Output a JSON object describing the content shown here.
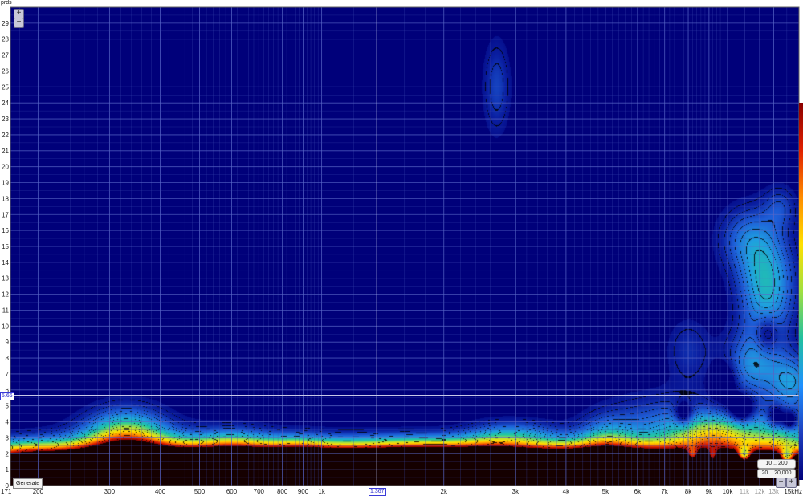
{
  "y_unit": "prds",
  "generate_label": "Generate",
  "range_buttons": [
    "10 .. 200",
    "20 .. 20,000"
  ],
  "cursor": {
    "x_label": "1.367",
    "y_label": "5.66"
  },
  "icons": {
    "zoom_in": "plus-icon",
    "zoom_out": "minus-icon"
  },
  "chart_data": {
    "type": "heatmap",
    "title": "",
    "xlabel": "",
    "ylabel": "prds",
    "x_scale": "log",
    "x_unit": "Hz",
    "xlim": [
      171,
      15000
    ],
    "ylim": [
      0,
      30
    ],
    "x_ticks": [
      {
        "value": 171,
        "label": "171"
      },
      {
        "value": 200,
        "label": "200"
      },
      {
        "value": 300,
        "label": "300"
      },
      {
        "value": 400,
        "label": "400"
      },
      {
        "value": 500,
        "label": "500"
      },
      {
        "value": 600,
        "label": "600"
      },
      {
        "value": 700,
        "label": "700"
      },
      {
        "value": 800,
        "label": "800"
      },
      {
        "value": 900,
        "label": "900"
      },
      {
        "value": 1000,
        "label": "1k"
      },
      {
        "value": 1367,
        "label": "1.367"
      },
      {
        "value": 2000,
        "label": "2k"
      },
      {
        "value": 3000,
        "label": "3k"
      },
      {
        "value": 4000,
        "label": "4k"
      },
      {
        "value": 5000,
        "label": "5k"
      },
      {
        "value": 6000,
        "label": "6k"
      },
      {
        "value": 7000,
        "label": "7k"
      },
      {
        "value": 8000,
        "label": "8k"
      },
      {
        "value": 9000,
        "label": "9k"
      },
      {
        "value": 10000,
        "label": "10k"
      },
      {
        "value": 11000,
        "label": "11k",
        "dim": true
      },
      {
        "value": 12000,
        "label": "12k",
        "dim": true
      },
      {
        "value": 13000,
        "label": "13k",
        "dim": true
      },
      {
        "value": 15000,
        "label": "15kHz"
      }
    ],
    "y_ticks": [
      0,
      1,
      2,
      3,
      4,
      5,
      6,
      7,
      8,
      9,
      10,
      11,
      12,
      13,
      14,
      15,
      16,
      17,
      18,
      19,
      20,
      21,
      22,
      23,
      24,
      25,
      26,
      27,
      28,
      29
    ],
    "cursor": {
      "x": 1367,
      "y": 5.66
    },
    "grid": true,
    "colormap": [
      "#00007a",
      "#0a1ea0",
      "#1e5fd8",
      "#1fa0e0",
      "#20c8a0",
      "#a8e040",
      "#ffe000",
      "#ff8c00",
      "#e02000",
      "#8b0000"
    ],
    "background_color": "#00137a",
    "blobs": [
      {
        "f": 200,
        "p": 0.3,
        "sf": 0.5,
        "sp": 1.1,
        "v": 1.0
      },
      {
        "f": 400,
        "p": 0.4,
        "sf": 0.5,
        "sp": 1.1,
        "v": 1.0
      },
      {
        "f": 700,
        "p": 0.4,
        "sf": 0.5,
        "sp": 1.1,
        "v": 1.0
      },
      {
        "f": 1200,
        "p": 0.4,
        "sf": 0.5,
        "sp": 1.1,
        "v": 1.0
      },
      {
        "f": 2000,
        "p": 0.4,
        "sf": 0.5,
        "sp": 1.1,
        "v": 1.0
      },
      {
        "f": 3500,
        "p": 0.4,
        "sf": 0.5,
        "sp": 1.1,
        "v": 1.0
      },
      {
        "f": 6000,
        "p": 0.4,
        "sf": 0.5,
        "sp": 1.1,
        "v": 1.0
      },
      {
        "f": 11000,
        "p": 0.4,
        "sf": 0.5,
        "sp": 1.1,
        "v": 1.0
      },
      {
        "f": 330,
        "p": 1.2,
        "sf": 0.1,
        "sp": 1.5,
        "v": 0.6
      },
      {
        "f": 330,
        "p": 3.0,
        "sf": 0.07,
        "sp": 1.3,
        "v": 0.45
      },
      {
        "f": 600,
        "p": 2.4,
        "sf": 0.07,
        "sp": 0.9,
        "v": 0.3
      },
      {
        "f": 190,
        "p": 2.0,
        "sf": 0.07,
        "sp": 0.7,
        "v": 0.25
      },
      {
        "f": 880,
        "p": 2.2,
        "sf": 0.05,
        "sp": 0.7,
        "v": 0.2
      },
      {
        "f": 1800,
        "p": 2.3,
        "sf": 0.1,
        "sp": 0.6,
        "v": 0.15
      },
      {
        "f": 2700,
        "p": 2.9,
        "sf": 0.06,
        "sp": 0.8,
        "v": 0.22
      },
      {
        "f": 3300,
        "p": 3.3,
        "sf": 0.06,
        "sp": 0.6,
        "v": 0.14
      },
      {
        "f": 5000,
        "p": 2.6,
        "sf": 0.05,
        "sp": 1.2,
        "v": 0.3
      },
      {
        "f": 7000,
        "p": 3.6,
        "sf": 0.1,
        "sp": 1.5,
        "v": 0.25
      },
      {
        "f": 9500,
        "p": 3.2,
        "sf": 0.07,
        "sp": 0.9,
        "v": 0.5
      },
      {
        "f": 13500,
        "p": 3.0,
        "sf": 0.06,
        "sp": 1.3,
        "v": 0.35
      },
      {
        "f": 14500,
        "p": 6.5,
        "sf": 0.04,
        "sp": 1.2,
        "v": 0.3
      },
      {
        "f": 11500,
        "p": 7.5,
        "sf": 0.05,
        "sp": 1.5,
        "v": 0.28
      },
      {
        "f": 12500,
        "p": 12.5,
        "sf": 0.05,
        "sp": 2.5,
        "v": 0.4
      },
      {
        "f": 11000,
        "p": 15.5,
        "sf": 0.05,
        "sp": 1.5,
        "v": 0.2
      },
      {
        "f": 13500,
        "p": 17.5,
        "sf": 0.03,
        "sp": 1.0,
        "v": 0.15
      },
      {
        "f": 8000,
        "p": 8.5,
        "sf": 0.04,
        "sp": 1.5,
        "v": 0.14
      },
      {
        "f": 2700,
        "p": 25.0,
        "sf": 0.025,
        "sp": 2.2,
        "v": 0.18
      }
    ],
    "holes": [
      {
        "f": 8200,
        "p": 1.7,
        "sf": 0.012,
        "sp": 0.4,
        "v": 0.8
      },
      {
        "f": 9200,
        "p": 1.6,
        "sf": 0.012,
        "sp": 0.4,
        "v": 0.8
      },
      {
        "f": 11000,
        "p": 1.8,
        "sf": 0.012,
        "sp": 0.4,
        "v": 0.8
      },
      {
        "f": 14000,
        "p": 1.7,
        "sf": 0.012,
        "sp": 0.4,
        "v": 0.8
      },
      {
        "f": 7800,
        "p": 4.5,
        "sf": 0.015,
        "sp": 0.5,
        "v": 0.3
      },
      {
        "f": 10800,
        "p": 4.8,
        "sf": 0.02,
        "sp": 0.6,
        "v": 0.35
      },
      {
        "f": 13200,
        "p": 4.3,
        "sf": 0.015,
        "sp": 0.5,
        "v": 0.3
      },
      {
        "f": 14200,
        "p": 4.1,
        "sf": 0.012,
        "sp": 0.4,
        "v": 0.35
      },
      {
        "f": 9800,
        "p": 6.5,
        "sf": 0.02,
        "sp": 0.8,
        "v": 0.25
      },
      {
        "f": 12500,
        "p": 9.5,
        "sf": 0.02,
        "sp": 0.8,
        "v": 0.2
      }
    ]
  }
}
